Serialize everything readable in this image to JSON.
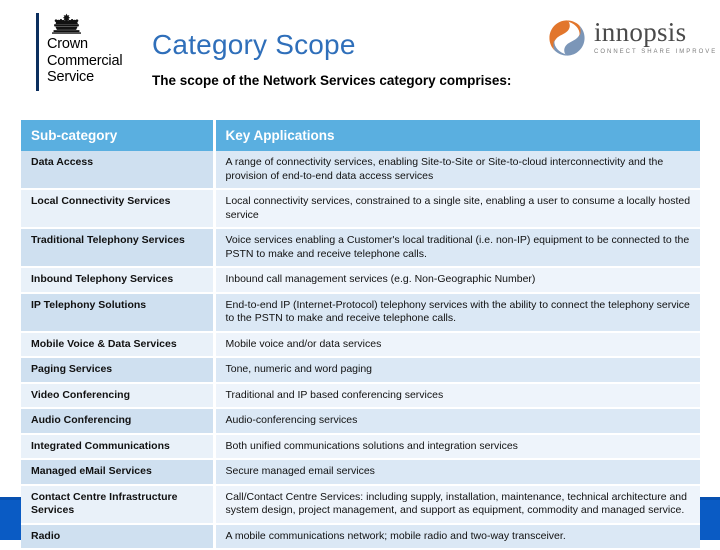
{
  "header": {
    "ccs_logo": {
      "icon": "royal-crown-icon",
      "line1": "Crown",
      "line2": "Commercial",
      "line3": "Service"
    },
    "title": "Category Scope",
    "subtitle": "The scope of the Network Services category comprises:",
    "partner_logo": {
      "icon": "innopsis-swirl-icon",
      "wordmark": "innopsis",
      "tagline": "CONNECT   SHARE   IMPROVE"
    }
  },
  "table": {
    "columns": [
      "Sub-category",
      "Key Applications"
    ],
    "rows": [
      {
        "sub_category": "Data Access",
        "key_applications": "A range of connectivity services, enabling Site-to-Site or Site-to-cloud interconnectivity and the provision of end-to-end data access services"
      },
      {
        "sub_category": "Local Connectivity Services",
        "key_applications": "Local connectivity services, constrained to a single site, enabling a user to consume a locally hosted service"
      },
      {
        "sub_category": "Traditional Telephony Services",
        "key_applications": "Voice services enabling a Customer's local traditional (i.e. non-IP) equipment to be connected to the PSTN to make and receive telephone calls."
      },
      {
        "sub_category": "Inbound Telephony Services",
        "key_applications": "Inbound call management services (e.g. Non-Geographic Number)"
      },
      {
        "sub_category": "IP Telephony Solutions",
        "key_applications": "End-to-end IP (Internet-Protocol) telephony services with the ability to connect the telephony service to the PSTN to make and receive telephone calls."
      },
      {
        "sub_category": "Mobile Voice & Data Services",
        "key_applications": "Mobile voice and/or data services"
      },
      {
        "sub_category": "Paging Services",
        "key_applications": "Tone, numeric and word paging"
      },
      {
        "sub_category": "Video Conferencing",
        "key_applications": "Traditional and IP based conferencing services"
      },
      {
        "sub_category": "Audio Conferencing",
        "key_applications": "Audio-conferencing services"
      },
      {
        "sub_category": "Integrated Communications",
        "key_applications": "Both unified communications solutions and integration services"
      },
      {
        "sub_category": "Managed eMail Services",
        "key_applications": "Secure managed email services"
      },
      {
        "sub_category": "Contact Centre Infrastructure Services",
        "key_applications": "Call/Contact Centre Services: including supply, installation, maintenance, technical architecture and system design, project management, and support as equipment, commodity and managed service."
      },
      {
        "sub_category": "Radio",
        "key_applications": "A mobile communications network; mobile radio and two-way transceiver."
      }
    ]
  },
  "colors": {
    "title_blue": "#2f6fba",
    "header_row_blue": "#5aafe0",
    "row_odd": "#cfe0f0",
    "row_even": "#e9f1f9",
    "footer_blue": "#0a5bc4",
    "innopsis_orange": "#e2762c",
    "innopsis_steel": "#7b96b8"
  }
}
